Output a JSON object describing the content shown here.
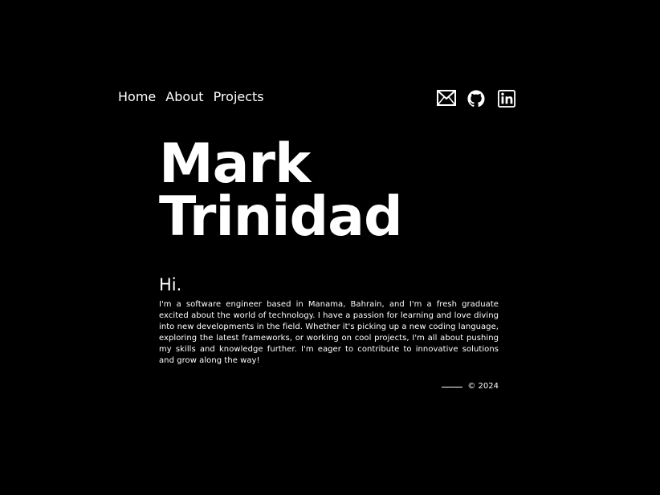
{
  "nav": {
    "items": [
      {
        "label": "Home"
      },
      {
        "label": "About"
      },
      {
        "label": "Projects"
      }
    ]
  },
  "socials": {
    "email_icon": "mail-icon",
    "github_icon": "github-icon",
    "linkedin_icon": "linkedin-icon"
  },
  "hero": {
    "first_name": "Mark",
    "last_name": "Trinidad"
  },
  "intro": {
    "greeting": "Hi.",
    "bio": "I'm a software engineer based in Manama, Bahrain, and I'm a fresh graduate excited about the world of technology. I have a passion for learning and love diving into new developments in the field. Whether it's picking up a new coding language, exploring the latest frameworks, or working on cool projects, I'm all about pushing my skills and knowledge further. I'm eager to contribute to innovative solutions and grow along the way!"
  },
  "footer": {
    "copyright": "© 2024"
  },
  "colors": {
    "background": "#000000",
    "text": "#ffffff"
  }
}
